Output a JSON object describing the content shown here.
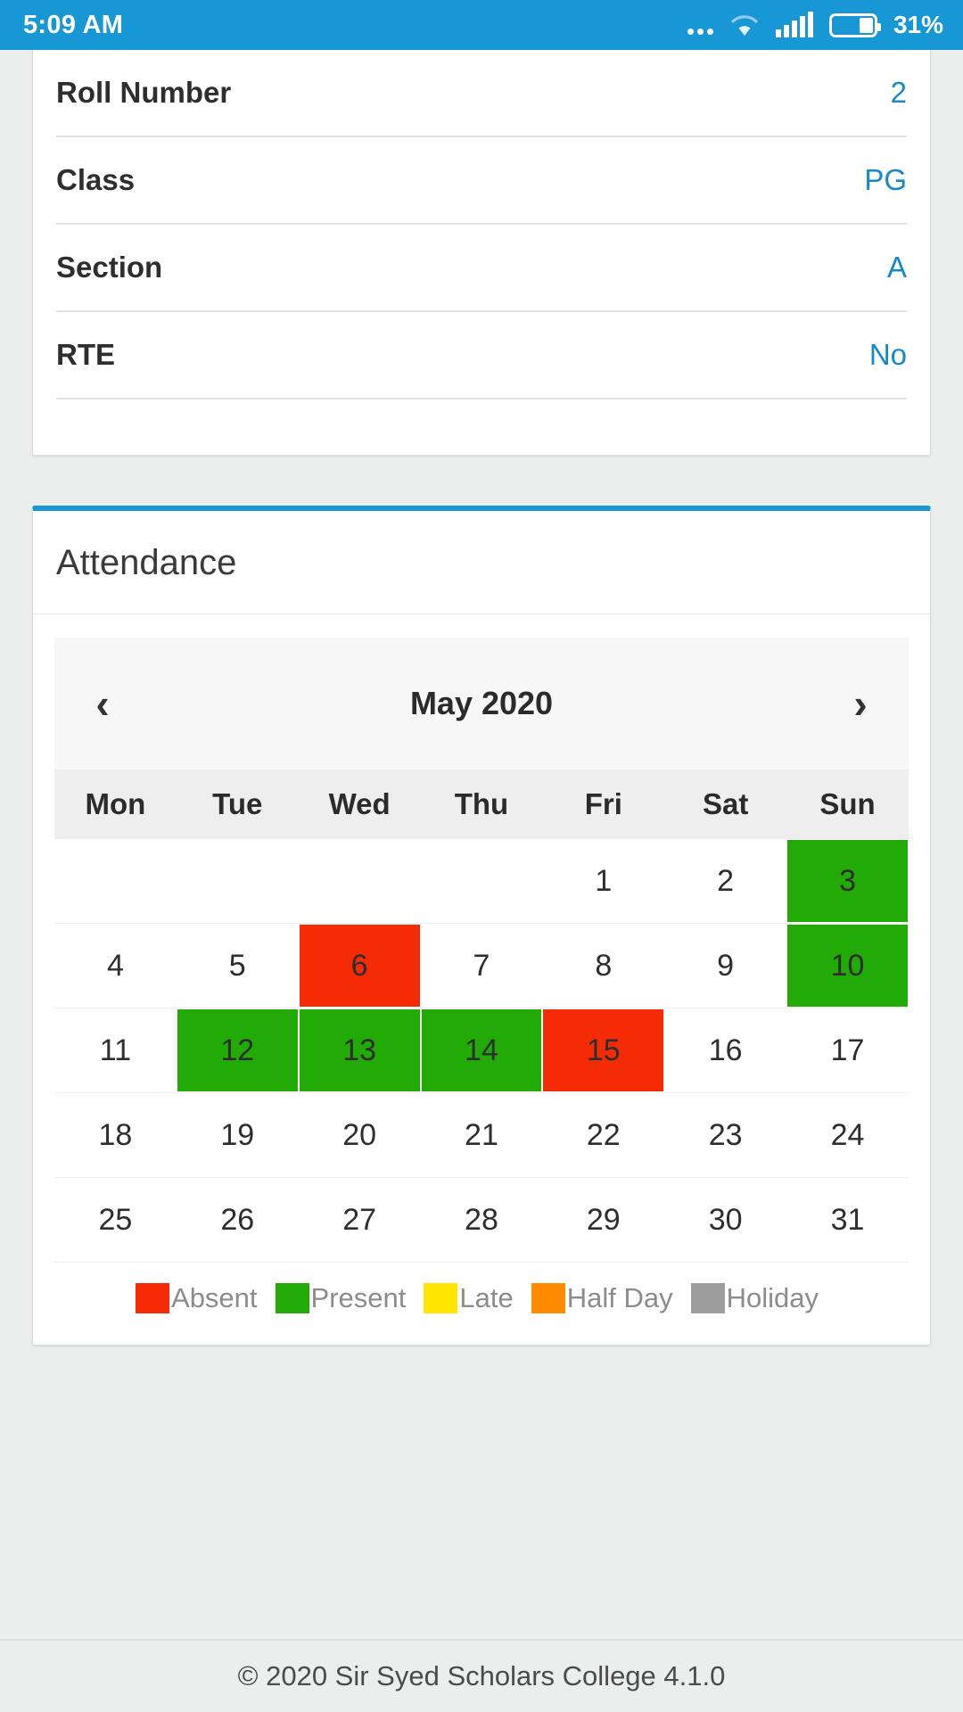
{
  "status_bar": {
    "time": "5:09 AM",
    "battery_percent": "31%",
    "icons": [
      "more-dots-icon",
      "wifi-icon",
      "signal-icon",
      "battery-icon"
    ],
    "background_color": "#1797d3"
  },
  "info_card": {
    "accent_color": "#1797d3",
    "rows": [
      {
        "label": "Roll Number",
        "value": "2"
      },
      {
        "label": "Class",
        "value": "PG"
      },
      {
        "label": "Section",
        "value": "A"
      },
      {
        "label": "RTE",
        "value": "No"
      }
    ]
  },
  "attendance": {
    "title": "Attendance",
    "accent_color": "#1797d3",
    "calendar": {
      "month_label": "May 2020",
      "prev_label": "‹",
      "next_label": "›",
      "weekdays": [
        "Mon",
        "Tue",
        "Wed",
        "Thu",
        "Fri",
        "Sat",
        "Sun"
      ],
      "weeks": [
        [
          {
            "day": ""
          },
          {
            "day": ""
          },
          {
            "day": ""
          },
          {
            "day": ""
          },
          {
            "day": "1",
            "status": "none"
          },
          {
            "day": "2",
            "status": "none"
          },
          {
            "day": "3",
            "status": "present"
          }
        ],
        [
          {
            "day": "4",
            "status": "none"
          },
          {
            "day": "5",
            "status": "none"
          },
          {
            "day": "6",
            "status": "absent"
          },
          {
            "day": "7",
            "status": "none"
          },
          {
            "day": "8",
            "status": "none"
          },
          {
            "day": "9",
            "status": "none"
          },
          {
            "day": "10",
            "status": "present"
          }
        ],
        [
          {
            "day": "11",
            "status": "none"
          },
          {
            "day": "12",
            "status": "present"
          },
          {
            "day": "13",
            "status": "present"
          },
          {
            "day": "14",
            "status": "present"
          },
          {
            "day": "15",
            "status": "absent"
          },
          {
            "day": "16",
            "status": "none"
          },
          {
            "day": "17",
            "status": "none"
          }
        ],
        [
          {
            "day": "18",
            "status": "none"
          },
          {
            "day": "19",
            "status": "none"
          },
          {
            "day": "20",
            "status": "none"
          },
          {
            "day": "21",
            "status": "none"
          },
          {
            "day": "22",
            "status": "none"
          },
          {
            "day": "23",
            "status": "none"
          },
          {
            "day": "24",
            "status": "none"
          }
        ],
        [
          {
            "day": "25",
            "status": "none"
          },
          {
            "day": "26",
            "status": "none"
          },
          {
            "day": "27",
            "status": "none"
          },
          {
            "day": "28",
            "status": "none"
          },
          {
            "day": "29",
            "status": "none"
          },
          {
            "day": "30",
            "status": "none"
          },
          {
            "day": "31",
            "status": "none"
          }
        ]
      ]
    },
    "legend": [
      {
        "label": "Absent",
        "status": "absent",
        "color": "#f52b05"
      },
      {
        "label": "Present",
        "status": "present",
        "color": "#22aa06"
      },
      {
        "label": "Late",
        "status": "late",
        "color": "#ffe600"
      },
      {
        "label": "Half Day",
        "status": "halfday",
        "color": "#ff8c00"
      },
      {
        "label": "Holiday",
        "status": "holiday",
        "color": "#9e9e9e"
      }
    ]
  },
  "footer": {
    "text": "© 2020 Sir Syed Scholars College 4.1.0"
  }
}
